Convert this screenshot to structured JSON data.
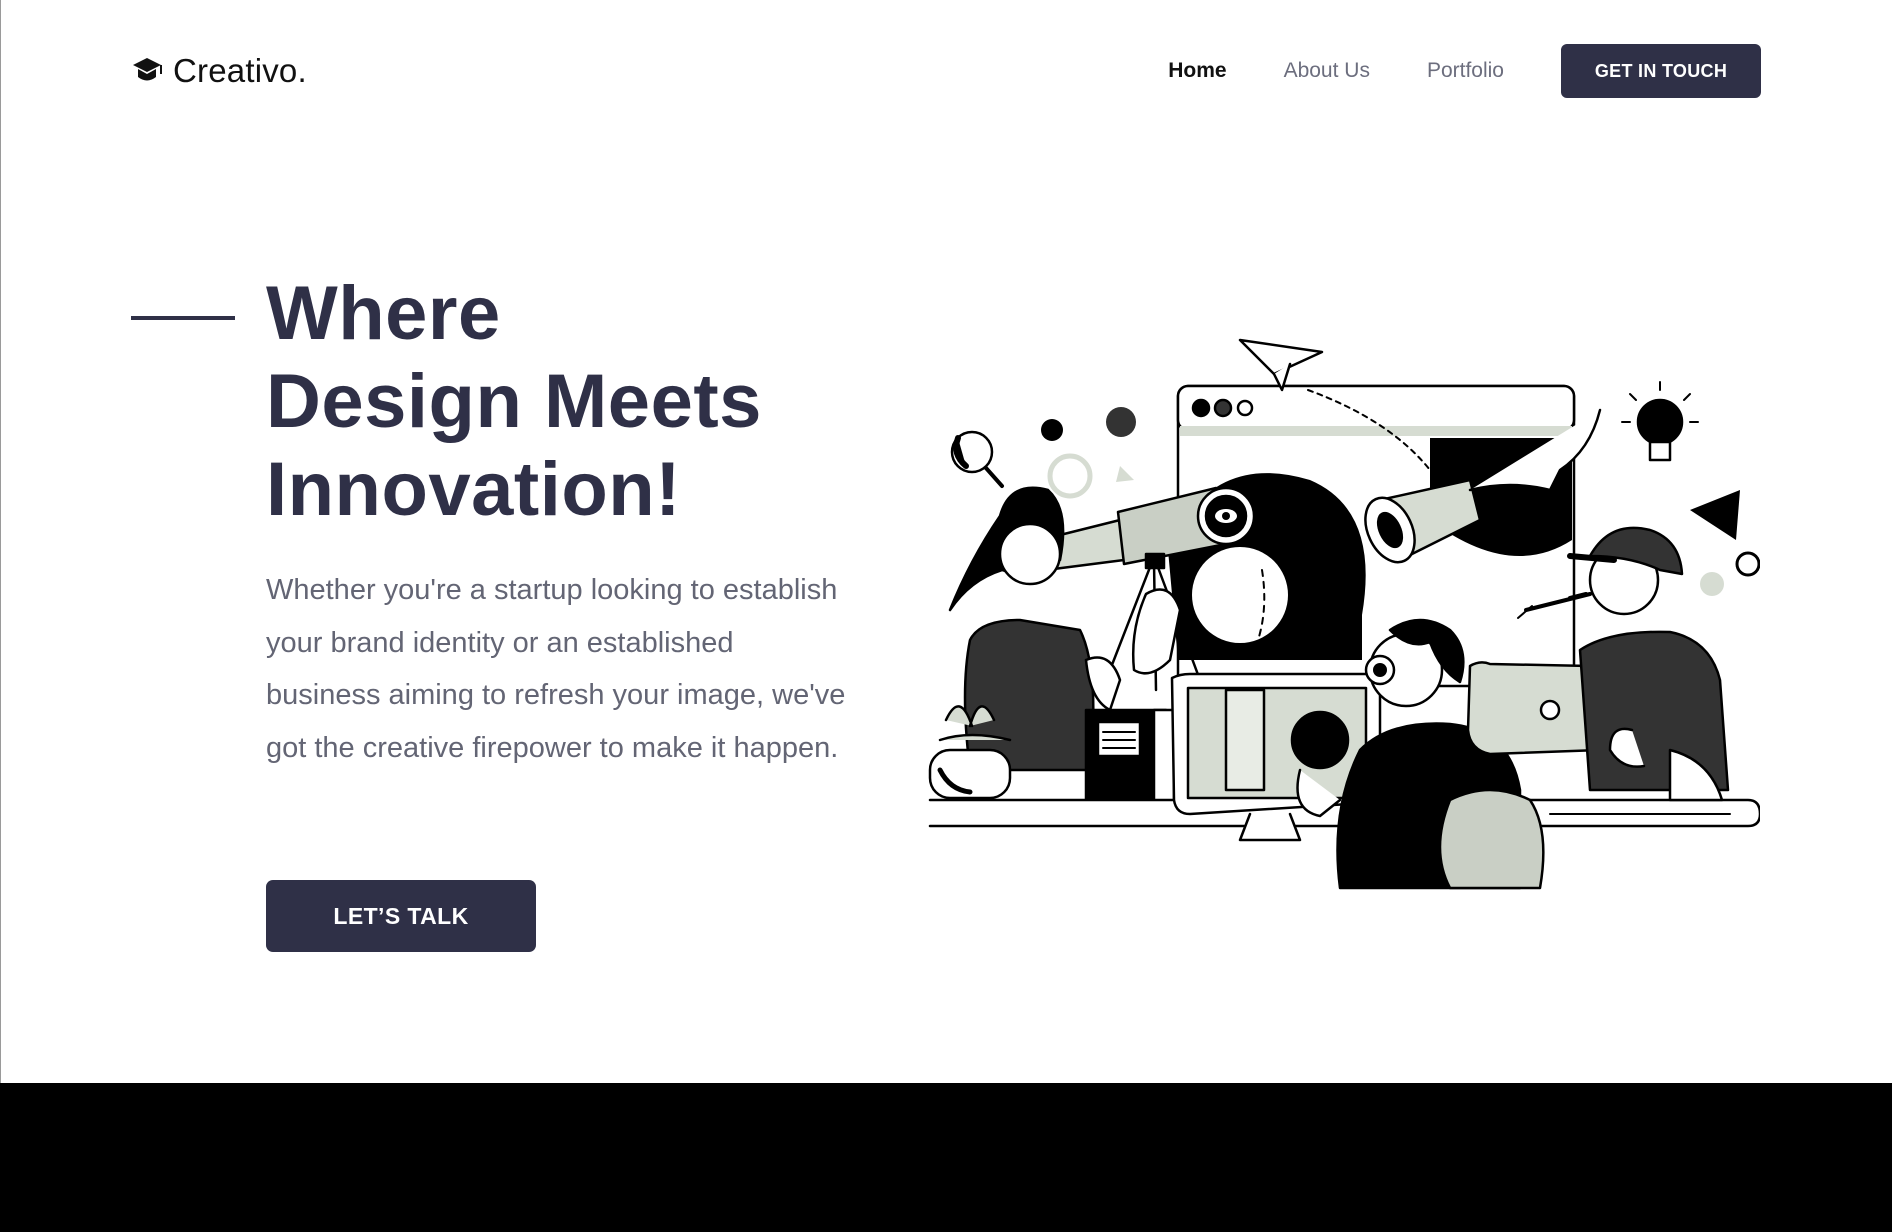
{
  "header": {
    "brand": {
      "name": "Creativo.",
      "icon": "graduation-cap-icon"
    },
    "nav": [
      {
        "label": "Home",
        "active": true
      },
      {
        "label": "About Us",
        "active": false
      },
      {
        "label": "Portfolio",
        "active": false
      }
    ],
    "cta_label": "GET IN TOUCH"
  },
  "hero": {
    "title_lines": [
      "Where",
      "Design Meets",
      "Innovation!"
    ],
    "description": "Whether you're a startup looking to establish your brand identity or an established business aiming to refresh your image, we've got the creative firepower to make it happen.",
    "cta_label": "LET’S TALK",
    "illustration": "creative-team-illustration"
  },
  "colors": {
    "primary": "#2f3047",
    "text_muted": "#636574",
    "nav_inactive": "#6c6e7e",
    "footer": "#000000",
    "illustration_accent": "#d6dcd2"
  }
}
